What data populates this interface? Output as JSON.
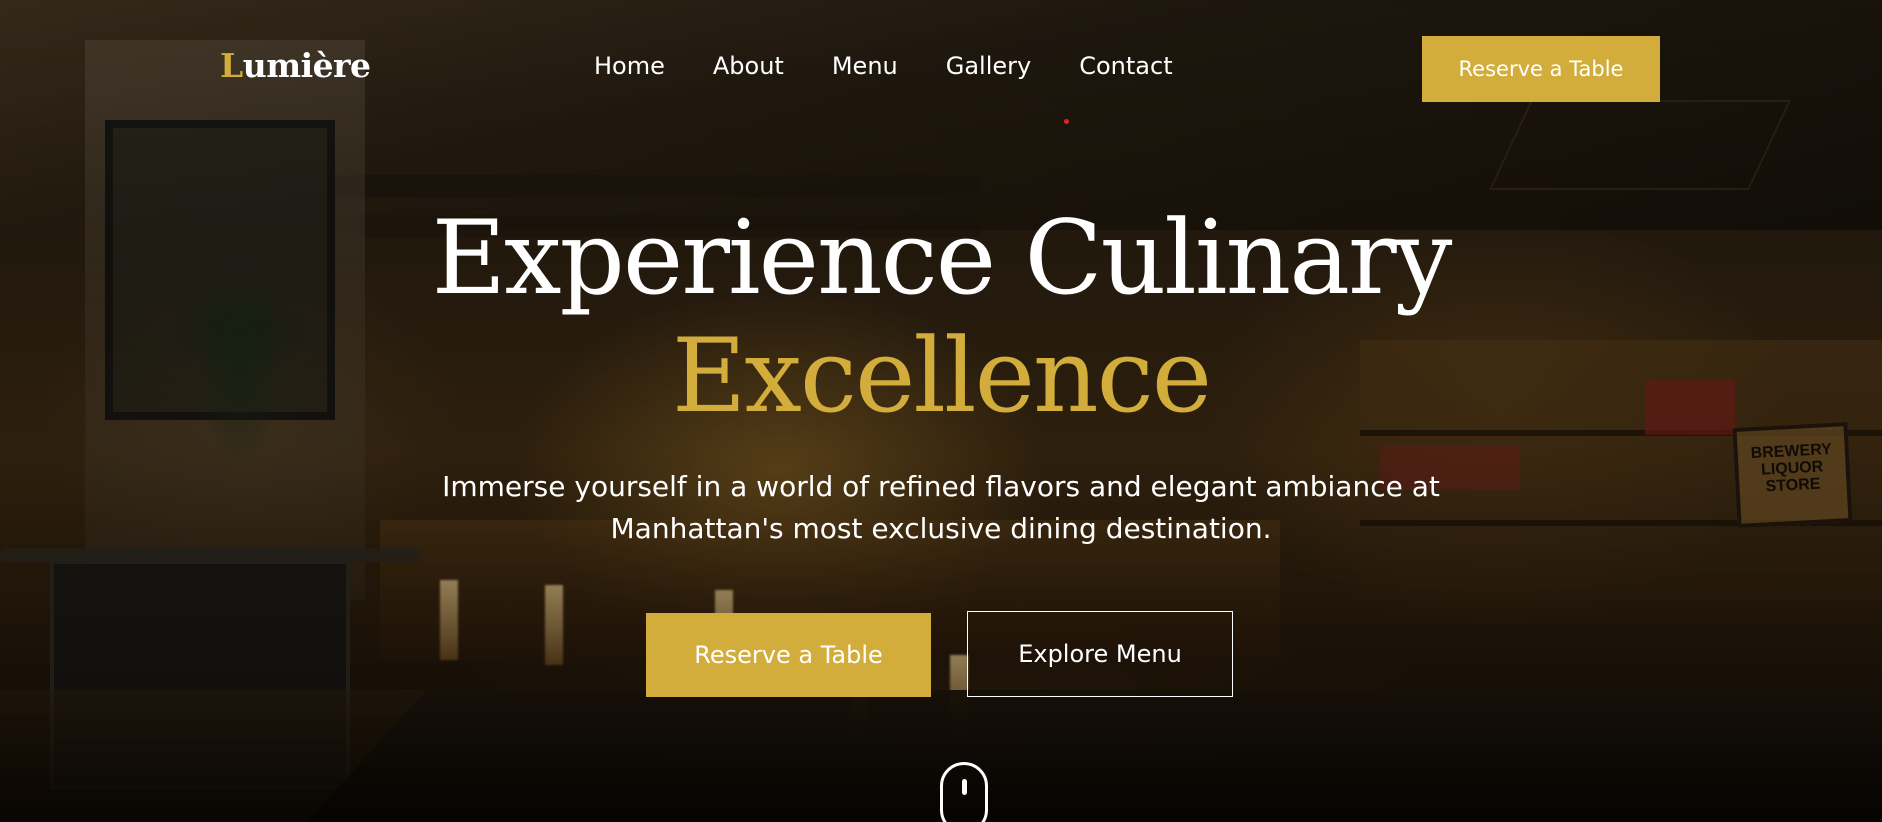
{
  "brand": {
    "initial": "L",
    "rest": "umière"
  },
  "nav": {
    "items": [
      {
        "label": "Home"
      },
      {
        "label": "About"
      },
      {
        "label": "Menu"
      },
      {
        "label": "Gallery"
      },
      {
        "label": "Contact"
      }
    ]
  },
  "header": {
    "cta_label": "Reserve a Table"
  },
  "hero": {
    "title_line1": "Experience Culinary",
    "title_line2": "Excellence",
    "subtitle": "Immerse yourself in a world of refined flavors and elegant ambiance at Manhattan's most exclusive dining destination.",
    "primary_cta": "Reserve a Table",
    "secondary_cta": "Explore Menu"
  },
  "background": {
    "sign_text": "BREWERY LIQUOR STORE"
  },
  "icons": {
    "scroll": "mouse-scroll-icon"
  },
  "colors": {
    "accent": "#d3ad3b",
    "text": "#ffffff",
    "nav_indicator": "#e0261c"
  }
}
